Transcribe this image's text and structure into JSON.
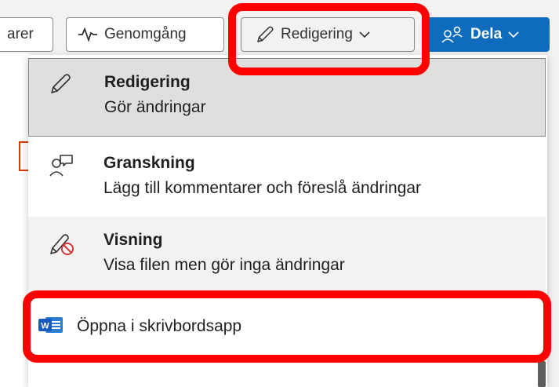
{
  "toolbar": {
    "partial_label": "arer",
    "review_label": "Genomgång",
    "edit_label": "Redigering",
    "share_label": "Dela"
  },
  "menu": {
    "items": [
      {
        "title": "Redigering",
        "description": "Gör ändringar",
        "icon": "pencil-icon"
      },
      {
        "title": "Granskning",
        "description": "Lägg till kommentarer och föreslå ändringar",
        "icon": "review-person-icon"
      },
      {
        "title": "Visning",
        "description": "Visa filen men gör inga ändringar",
        "icon": "no-edit-icon"
      }
    ],
    "desktop": {
      "label": "Öppna i skrivbordsapp",
      "icon": "word-icon"
    }
  },
  "colors": {
    "accent": "#0f6cbd",
    "highlight": "#ff0000",
    "selected": "#e1dfdd",
    "word": "#185abd"
  }
}
